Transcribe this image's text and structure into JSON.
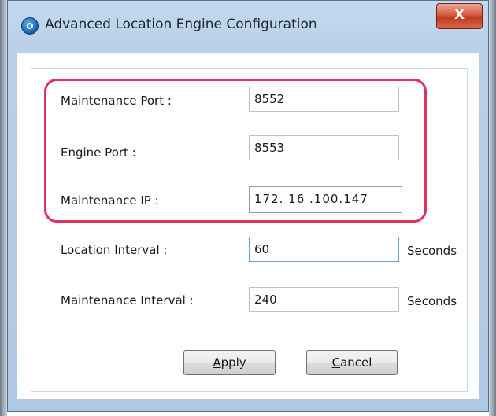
{
  "window": {
    "title": "Advanced Location Engine Configuration",
    "close_label": "X"
  },
  "form": {
    "maintenance_port": {
      "label": "Maintenance Port :",
      "value": "8552"
    },
    "engine_port": {
      "label": "Engine Port :",
      "value": "8553"
    },
    "maintenance_ip": {
      "label": "Maintenance IP :",
      "value": "172. 16 .100.147"
    },
    "location_interval": {
      "label": "Location Interval :",
      "value": "60",
      "unit": "Seconds"
    },
    "maintenance_interval": {
      "label": "Maintenance Interval :",
      "value": "240",
      "unit": "Seconds"
    }
  },
  "buttons": {
    "apply": {
      "mnemonic": "A",
      "rest": "pply"
    },
    "cancel": {
      "mnemonic": "C",
      "rest": "ancel"
    }
  },
  "colors": {
    "highlight_border": "#e0315f",
    "titlebar": "#b9d0e8",
    "close_button": "#c13a1e"
  }
}
